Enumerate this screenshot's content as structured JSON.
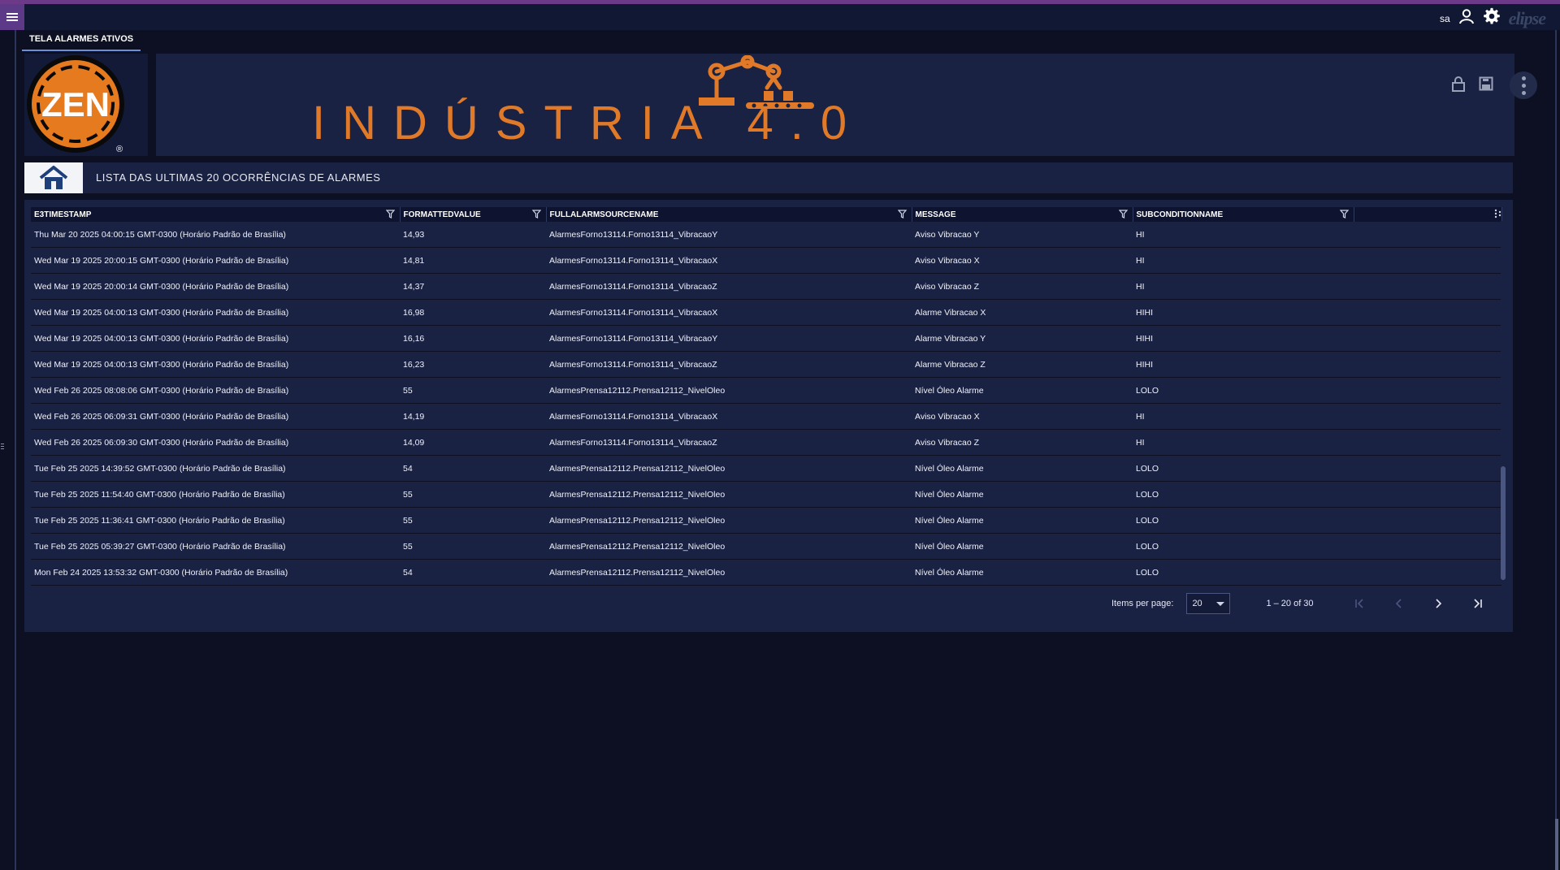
{
  "topbar": {
    "user": "sa",
    "brand": "elipse",
    "icons": [
      "menu-icon",
      "user-icon",
      "gear-icon"
    ]
  },
  "tab": {
    "label": "TELA ALARMES ATIVOS"
  },
  "header": {
    "logo_text": "ZEN",
    "logo_registered": "®",
    "banner_title": "INDÚSTRIA 4.0",
    "colors": {
      "orange": "#e07a28",
      "panel": "#1a2244",
      "background": "#0c1022"
    }
  },
  "section": {
    "title": "LISTA DAS ULTIMAS 20 OCORRÊNCIAS DE ALARMES"
  },
  "table": {
    "columns": [
      "E3TIMESTAMP",
      "FORMATTEDVALUE",
      "FULLALARMSOURCENAME",
      "MESSAGE",
      "SUBCONDITIONNAME"
    ],
    "rows": [
      [
        "Thu Mar 20 2025 04:00:15 GMT-0300 (Horário Padrão de Brasília)",
        "14,93",
        "AlarmesForno13114.Forno13114_VibracaoY",
        "Aviso Vibracao Y",
        "HI"
      ],
      [
        "Wed Mar 19 2025 20:00:15 GMT-0300 (Horário Padrão de Brasília)",
        "14,81",
        "AlarmesForno13114.Forno13114_VibracaoX",
        "Aviso Vibracao X",
        "HI"
      ],
      [
        "Wed Mar 19 2025 20:00:14 GMT-0300 (Horário Padrão de Brasília)",
        "14,37",
        "AlarmesForno13114.Forno13114_VibracaoZ",
        "Aviso Vibracao Z",
        "HI"
      ],
      [
        "Wed Mar 19 2025 04:00:13 GMT-0300 (Horário Padrão de Brasília)",
        "16,98",
        "AlarmesForno13114.Forno13114_VibracaoX",
        "Alarme Vibracao X",
        "HIHI"
      ],
      [
        "Wed Mar 19 2025 04:00:13 GMT-0300 (Horário Padrão de Brasília)",
        "16,16",
        "AlarmesForno13114.Forno13114_VibracaoY",
        "Alarme Vibracao Y",
        "HIHI"
      ],
      [
        "Wed Mar 19 2025 04:00:13 GMT-0300 (Horário Padrão de Brasília)",
        "16,23",
        "AlarmesForno13114.Forno13114_VibracaoZ",
        "Alarme Vibracao Z",
        "HIHI"
      ],
      [
        "Wed Feb 26 2025 08:08:06 GMT-0300 (Horário Padrão de Brasília)",
        "55",
        "AlarmesPrensa12112.Prensa12112_NivelOleo",
        "Nível Óleo Alarme",
        "LOLO"
      ],
      [
        "Wed Feb 26 2025 06:09:31 GMT-0300 (Horário Padrão de Brasília)",
        "14,19",
        "AlarmesForno13114.Forno13114_VibracaoX",
        "Aviso Vibracao X",
        "HI"
      ],
      [
        "Wed Feb 26 2025 06:09:30 GMT-0300 (Horário Padrão de Brasília)",
        "14,09",
        "AlarmesForno13114.Forno13114_VibracaoZ",
        "Aviso Vibracao Z",
        "HI"
      ],
      [
        "Tue Feb 25 2025 14:39:52 GMT-0300 (Horário Padrão de Brasília)",
        "54",
        "AlarmesPrensa12112.Prensa12112_NivelOleo",
        "Nível Óleo Alarme",
        "LOLO"
      ],
      [
        "Tue Feb 25 2025 11:54:40 GMT-0300 (Horário Padrão de Brasília)",
        "55",
        "AlarmesPrensa12112.Prensa12112_NivelOleo",
        "Nível Óleo Alarme",
        "LOLO"
      ],
      [
        "Tue Feb 25 2025 11:36:41 GMT-0300 (Horário Padrão de Brasília)",
        "55",
        "AlarmesPrensa12112.Prensa12112_NivelOleo",
        "Nível Óleo Alarme",
        "LOLO"
      ],
      [
        "Tue Feb 25 2025 05:39:27 GMT-0300 (Horário Padrão de Brasília)",
        "55",
        "AlarmesPrensa12112.Prensa12112_NivelOleo",
        "Nível Óleo Alarme",
        "LOLO"
      ],
      [
        "Mon Feb 24 2025 13:53:32 GMT-0300 (Horário Padrão de Brasília)",
        "54",
        "AlarmesPrensa12112.Prensa12112_NivelOleo",
        "Nível Óleo Alarme",
        "LOLO"
      ]
    ]
  },
  "paginator": {
    "items_per_page_label": "Items per page:",
    "items_per_page_value": "20",
    "range_label": "1 – 20 of 30"
  }
}
